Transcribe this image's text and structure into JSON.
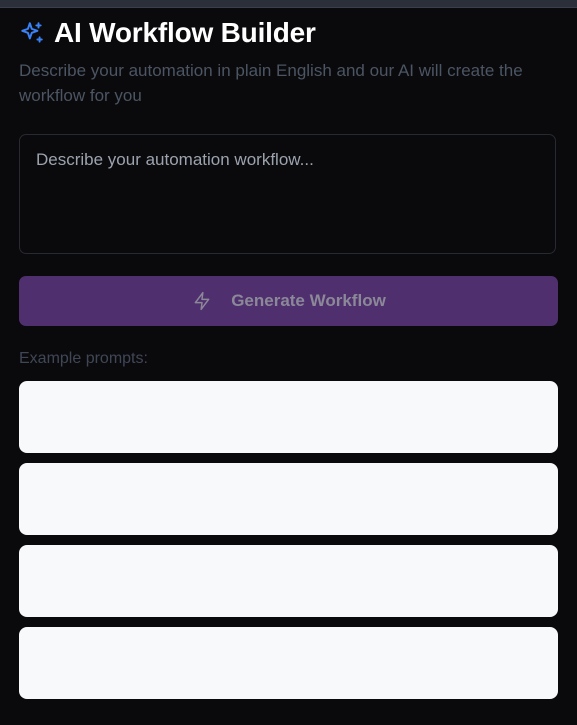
{
  "header": {
    "title": "AI Workflow Builder",
    "subtitle": "Describe your automation in plain English and our AI will create the workflow for you",
    "icon": "sparkles-icon",
    "icon_color": "#3b82f6"
  },
  "input": {
    "placeholder": "Describe your automation workflow...",
    "value": ""
  },
  "generate_button": {
    "label": "Generate Workflow",
    "icon": "zap-icon",
    "background": "#4f2f6e"
  },
  "examples": {
    "label": "Example prompts:",
    "prompts": [
      "",
      "",
      "",
      ""
    ]
  }
}
